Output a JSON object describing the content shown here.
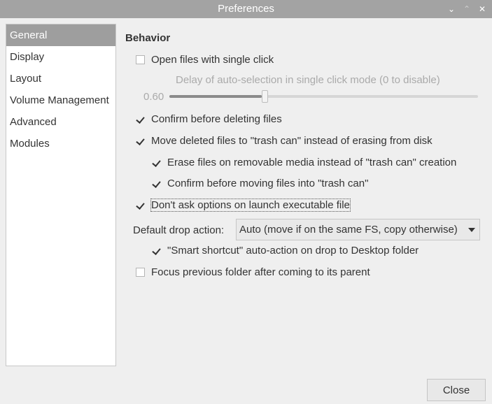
{
  "window": {
    "title": "Preferences",
    "buttons": {
      "minimize": "⌄",
      "maximize": "⌃",
      "close": "✕"
    }
  },
  "sidebar": {
    "items": [
      {
        "label": "General",
        "selected": true
      },
      {
        "label": "Display",
        "selected": false
      },
      {
        "label": "Layout",
        "selected": false
      },
      {
        "label": "Volume Management",
        "selected": false
      },
      {
        "label": "Advanced",
        "selected": false
      },
      {
        "label": "Modules",
        "selected": false
      }
    ]
  },
  "behavior": {
    "title": "Behavior",
    "single_click": {
      "label": "Open files with single click",
      "checked": false
    },
    "delay_hint": "Delay of auto-selection in single click mode (0 to disable)",
    "delay_value": "0.60",
    "delay_fraction": 0.3,
    "confirm_delete": {
      "label": "Confirm before deleting files",
      "checked": true
    },
    "trash": {
      "label": "Move deleted files to \"trash can\" instead of erasing from disk",
      "checked": true
    },
    "erase_removable": {
      "label": "Erase files on removable media instead of \"trash can\" creation",
      "checked": true
    },
    "confirm_trash": {
      "label": "Confirm before moving files into \"trash can\"",
      "checked": true
    },
    "dont_ask_exec": {
      "label": "Don't ask options on launch executable file",
      "checked": true
    },
    "drop_action_label": "Default drop action:",
    "drop_action_value": "Auto (move if on the same FS, copy otherwise)",
    "smart_shortcut": {
      "label": "\"Smart shortcut\" auto-action on drop to Desktop folder",
      "checked": true
    },
    "focus_previous": {
      "label": "Focus previous folder after coming to its parent",
      "checked": false
    }
  },
  "footer": {
    "close_label": "Close"
  }
}
